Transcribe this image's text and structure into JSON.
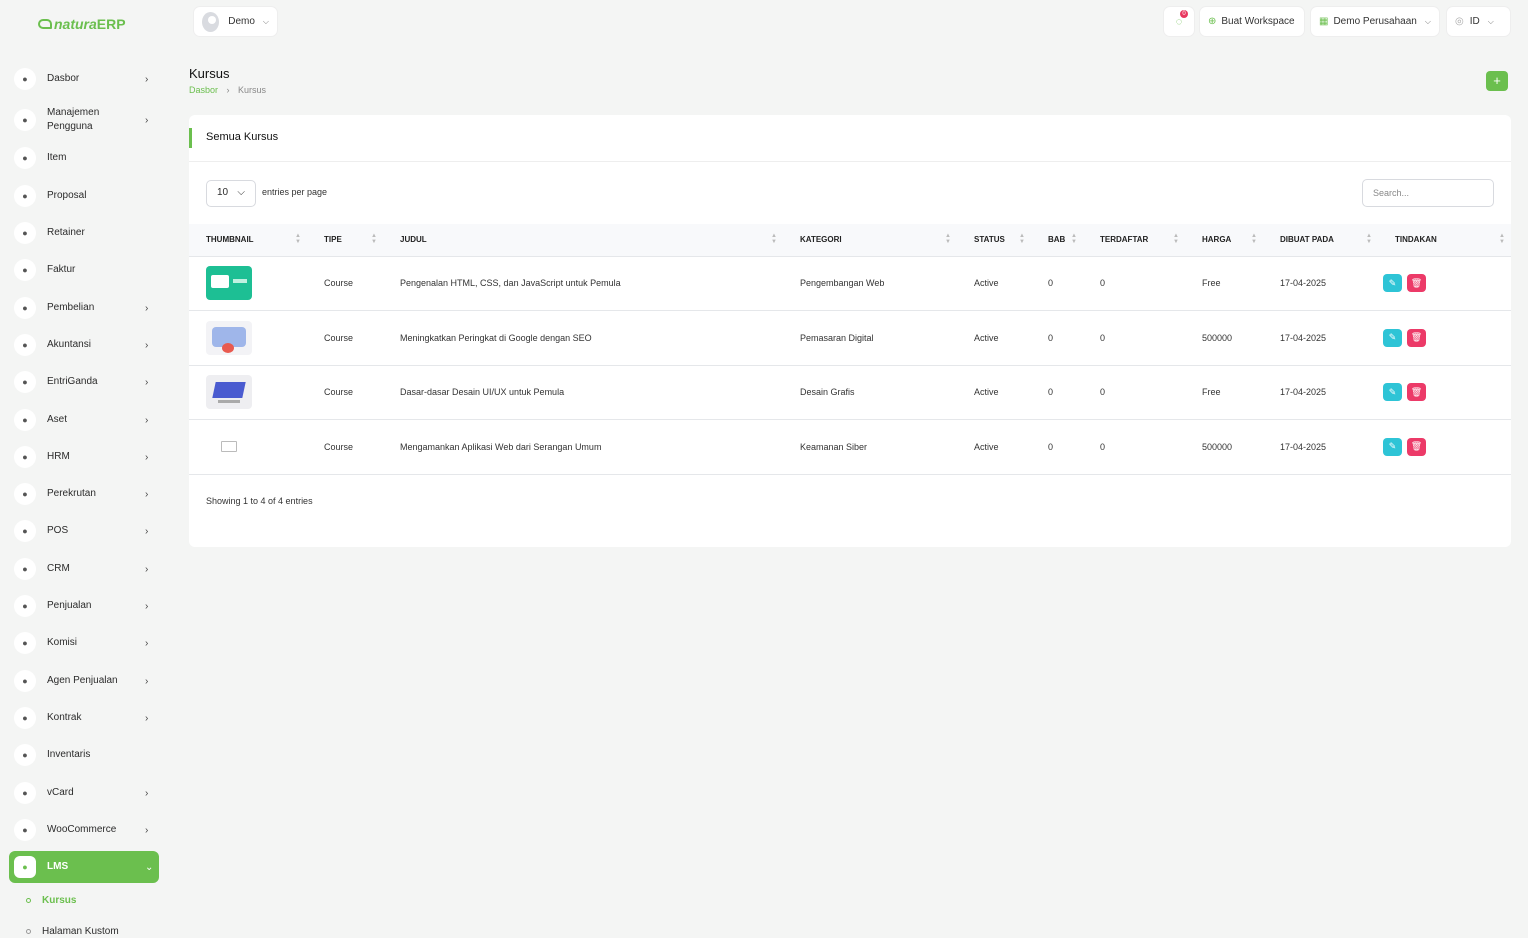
{
  "app": {
    "logo_main": "natura",
    "logo_suffix": "ERP"
  },
  "sidebar": {
    "items": [
      {
        "label": "Dasbor",
        "icon": "home-icon",
        "chevron": true
      },
      {
        "label": "Manajemen Pengguna",
        "icon": "users-icon",
        "chevron": true
      },
      {
        "label": "Item",
        "icon": "cart-icon",
        "chevron": false
      },
      {
        "label": "Proposal",
        "icon": "proposal-icon",
        "chevron": false
      },
      {
        "label": "Retainer",
        "icon": "retainer-icon",
        "chevron": false
      },
      {
        "label": "Faktur",
        "icon": "invoice-icon",
        "chevron": false
      },
      {
        "label": "Pembelian",
        "icon": "purchase-icon",
        "chevron": true
      },
      {
        "label": "Akuntansi",
        "icon": "accounting-icon",
        "chevron": true
      },
      {
        "label": "EntriGanda",
        "icon": "scale-icon",
        "chevron": true
      },
      {
        "label": "Aset",
        "icon": "calculator-icon",
        "chevron": true
      },
      {
        "label": "HRM",
        "icon": "hrm-icon",
        "chevron": true
      },
      {
        "label": "Perekrutan",
        "icon": "user-plus-icon",
        "chevron": true
      },
      {
        "label": "POS",
        "icon": "grid-icon",
        "chevron": true
      },
      {
        "label": "CRM",
        "icon": "crm-icon",
        "chevron": true
      },
      {
        "label": "Penjualan",
        "icon": "sales-icon",
        "chevron": true
      },
      {
        "label": "Komisi",
        "icon": "commission-icon",
        "chevron": true
      },
      {
        "label": "Agen Penjualan",
        "icon": "agent-icon",
        "chevron": true
      },
      {
        "label": "Kontrak",
        "icon": "contract-icon",
        "chevron": true
      },
      {
        "label": "Inventaris",
        "icon": "inventory-icon",
        "chevron": false
      },
      {
        "label": "vCard",
        "icon": "card-icon",
        "chevron": true
      },
      {
        "label": "WooCommerce",
        "icon": "woocommerce-icon",
        "chevron": true
      },
      {
        "label": "LMS",
        "icon": "book-icon",
        "chevron": true,
        "active": true
      }
    ],
    "subitems": [
      {
        "label": "Kursus",
        "active": true
      },
      {
        "label": "Halaman Kustom",
        "active": false
      }
    ]
  },
  "header": {
    "user": "Demo",
    "notification_count": "0",
    "create_workspace": "Buat Workspace",
    "company": "Demo Perusahaan",
    "language": "ID"
  },
  "page": {
    "title": "Kursus",
    "breadcrumb": [
      "Dasbor",
      "Kursus"
    ],
    "add_button": "+"
  },
  "card": {
    "title": "Semua Kursus",
    "entries_value": "10",
    "entries_label": "entries per page",
    "search_placeholder": "Search...",
    "info": "Showing 1 to 4 of 4 entries"
  },
  "table": {
    "columns": [
      "THUMBNAIL",
      "TIPE",
      "JUDUL",
      "KATEGORI",
      "STATUS",
      "BAB",
      "TERDAFTAR",
      "HARGA",
      "DIBUAT PADA",
      "TINDAKAN"
    ],
    "rows": [
      {
        "thumb": "t1",
        "tipe": "Course",
        "judul": "Pengenalan HTML, CSS, dan JavaScript untuk Pemula",
        "kategori": "Pengembangan Web",
        "status": "Active",
        "bab": "0",
        "terdaftar": "0",
        "harga": "Free",
        "dibuat": "17-04-2025"
      },
      {
        "thumb": "t2",
        "tipe": "Course",
        "judul": "Meningkatkan Peringkat di Google dengan SEO",
        "kategori": "Pemasaran Digital",
        "status": "Active",
        "bab": "0",
        "terdaftar": "0",
        "harga": "500000",
        "dibuat": "17-04-2025"
      },
      {
        "thumb": "t3",
        "tipe": "Course",
        "judul": "Dasar-dasar Desain UI/UX untuk Pemula",
        "kategori": "Desain Grafis",
        "status": "Active",
        "bab": "0",
        "terdaftar": "0",
        "harga": "Free",
        "dibuat": "17-04-2025"
      },
      {
        "thumb": "t4",
        "tipe": "Course",
        "judul": "Mengamankan Aplikasi Web dari Serangan Umum",
        "kategori": "Keamanan Siber",
        "status": "Active",
        "bab": "0",
        "terdaftar": "0",
        "harga": "500000",
        "dibuat": "17-04-2025"
      }
    ]
  },
  "colors": {
    "accent": "#6bbf4e",
    "edit": "#2ec4d6",
    "delete": "#ec3a68"
  }
}
